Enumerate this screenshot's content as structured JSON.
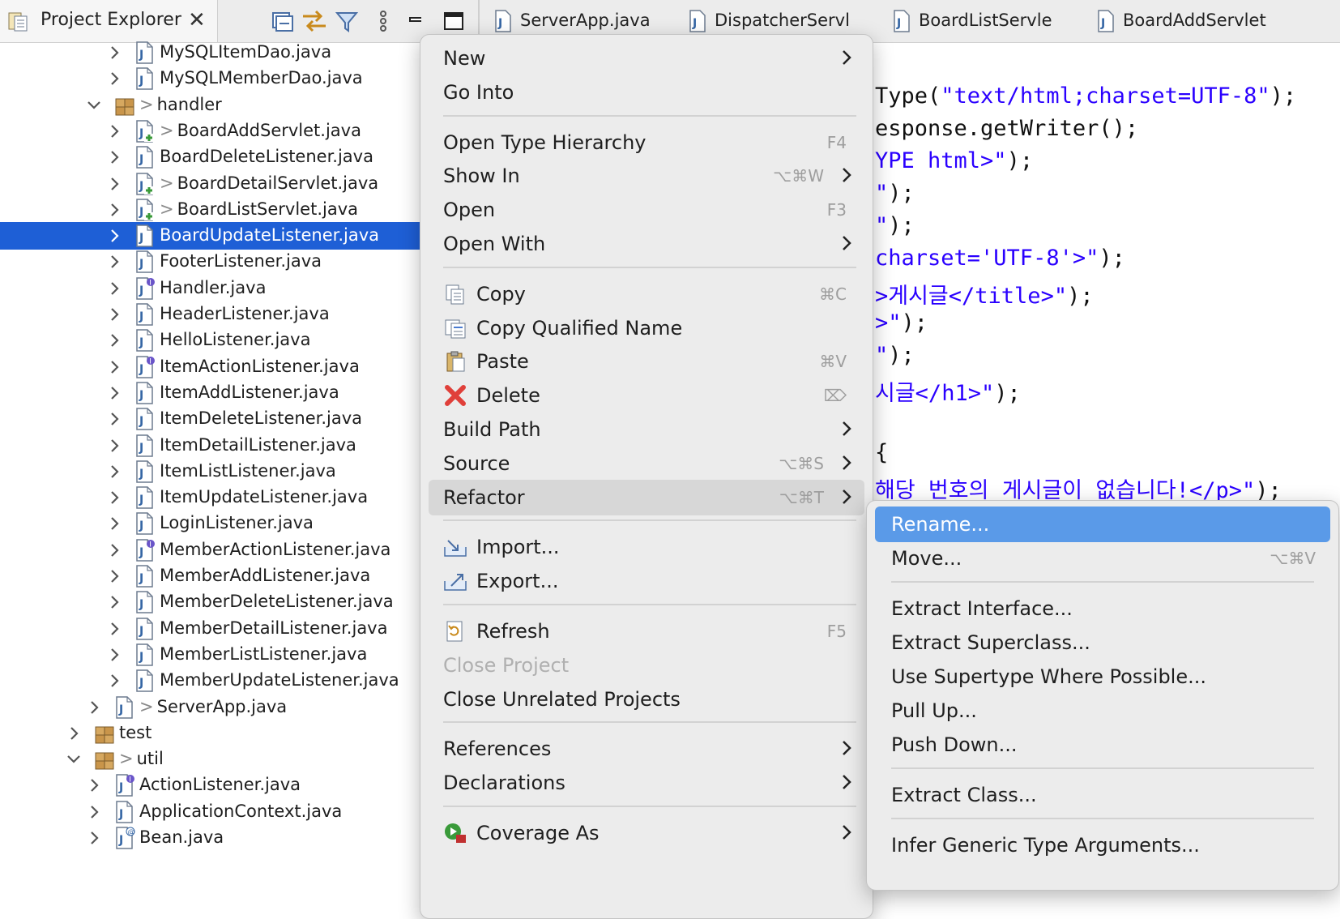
{
  "explorer": {
    "title": "Project Explorer",
    "close_glyph": "✕",
    "toolbar": [
      "collapse-all-icon",
      "link-with-editor-icon",
      "filter-icon",
      "view-menu-icon",
      "minimize-icon",
      "maximize-icon"
    ],
    "tree": [
      {
        "label": "MySQLItemDao.java",
        "icon": "java-file-icon",
        "prefix": ""
      },
      {
        "label": "MySQLMemberDao.java",
        "icon": "java-file-icon",
        "prefix": ""
      },
      {
        "label": "handler",
        "icon": "package-icon",
        "prefix": ">"
      },
      {
        "label": "BoardAddServlet.java",
        "icon": "java-file-added-icon",
        "prefix": ">"
      },
      {
        "label": "BoardDeleteListener.java",
        "icon": "java-file-icon",
        "prefix": ""
      },
      {
        "label": "BoardDetailServlet.java",
        "icon": "java-file-added-icon",
        "prefix": ">"
      },
      {
        "label": "BoardListServlet.java",
        "icon": "java-file-added-icon",
        "prefix": ">"
      },
      {
        "label": "BoardUpdateListener.java",
        "icon": "java-file-icon",
        "prefix": "",
        "selected": true
      },
      {
        "label": "FooterListener.java",
        "icon": "java-file-icon",
        "prefix": ""
      },
      {
        "label": "Handler.java",
        "icon": "java-interface-file-icon",
        "prefix": ""
      },
      {
        "label": "HeaderListener.java",
        "icon": "java-file-icon",
        "prefix": ""
      },
      {
        "label": "HelloListener.java",
        "icon": "java-file-icon",
        "prefix": ""
      },
      {
        "label": "ItemActionListener.java",
        "icon": "java-interface-file-icon",
        "prefix": ""
      },
      {
        "label": "ItemAddListener.java",
        "icon": "java-file-icon",
        "prefix": ""
      },
      {
        "label": "ItemDeleteListener.java",
        "icon": "java-file-icon",
        "prefix": ""
      },
      {
        "label": "ItemDetailListener.java",
        "icon": "java-file-icon",
        "prefix": ""
      },
      {
        "label": "ItemListListener.java",
        "icon": "java-file-icon",
        "prefix": ""
      },
      {
        "label": "ItemUpdateListener.java",
        "icon": "java-file-icon",
        "prefix": ""
      },
      {
        "label": "LoginListener.java",
        "icon": "java-file-icon",
        "prefix": ""
      },
      {
        "label": "MemberActionListener.java",
        "icon": "java-interface-file-icon",
        "prefix": ""
      },
      {
        "label": "MemberAddListener.java",
        "icon": "java-file-icon",
        "prefix": ""
      },
      {
        "label": "MemberDeleteListener.java",
        "icon": "java-file-icon",
        "prefix": ""
      },
      {
        "label": "MemberDetailListener.java",
        "icon": "java-file-icon",
        "prefix": ""
      },
      {
        "label": "MemberListListener.java",
        "icon": "java-file-icon",
        "prefix": ""
      },
      {
        "label": "MemberUpdateListener.java",
        "icon": "java-file-icon",
        "prefix": ""
      },
      {
        "label": "ServerApp.java",
        "icon": "java-file-icon",
        "prefix": ">"
      },
      {
        "label": "test",
        "icon": "package-icon",
        "prefix": ""
      },
      {
        "label": "util",
        "icon": "package-icon",
        "prefix": ">"
      },
      {
        "label": "ActionListener.java",
        "icon": "java-interface-file-icon",
        "prefix": ""
      },
      {
        "label": "ApplicationContext.java",
        "icon": "java-file-icon",
        "prefix": ""
      },
      {
        "label": "Bean.java",
        "icon": "java-annotation-file-icon",
        "prefix": ""
      }
    ]
  },
  "editor": {
    "tabs": [
      "ServerApp.java",
      "DispatcherServl",
      "BoardListServle",
      "BoardAddServlet"
    ],
    "code_lines": [
      {
        "parts": [
          {
            "t": "Type(",
            "c": "pl"
          },
          {
            "t": "\"text/html;charset=UTF-8\"",
            "c": "str"
          },
          {
            "t": ");",
            "c": "pl"
          }
        ]
      },
      {
        "parts": [
          {
            "t": "esponse.getWriter();",
            "c": "pl"
          }
        ]
      },
      {
        "parts": [
          {
            "t": "YPE html>\"",
            "c": "str"
          },
          {
            "t": ");",
            "c": "pl"
          }
        ]
      },
      {
        "parts": [
          {
            "t": "\"",
            "c": "str"
          },
          {
            "t": ");",
            "c": "pl"
          }
        ]
      },
      {
        "parts": [
          {
            "t": "\"",
            "c": "str"
          },
          {
            "t": ");",
            "c": "pl"
          }
        ]
      },
      {
        "parts": [
          {
            "t": "charset='UTF-8'>\"",
            "c": "str"
          },
          {
            "t": ");",
            "c": "pl"
          }
        ]
      },
      {
        "parts": [
          {
            "t": ">게시글</title>\"",
            "c": "str"
          },
          {
            "t": ");",
            "c": "pl"
          }
        ]
      },
      {
        "parts": [
          {
            "t": ">\"",
            "c": "str"
          },
          {
            "t": ");",
            "c": "pl"
          }
        ]
      },
      {
        "parts": [
          {
            "t": "\"",
            "c": "str"
          },
          {
            "t": ");",
            "c": "pl"
          }
        ]
      },
      {
        "parts": [
          {
            "t": "시글</h1>\"",
            "c": "str"
          },
          {
            "t": ");",
            "c": "pl"
          }
        ]
      },
      {
        "parts": []
      },
      {
        "parts": [
          {
            "t": "{",
            "c": "pl"
          }
        ]
      },
      {
        "parts": [
          {
            "t": "해당 번호의 게시글이 없습니다!</p>\"",
            "c": "str"
          },
          {
            "t": ");",
            "c": "pl"
          }
        ]
      }
    ]
  },
  "context_menu": {
    "items": [
      {
        "label": "New",
        "shortcut": "",
        "submenu": true
      },
      {
        "label": "Go Into",
        "shortcut": "",
        "submenu": false
      },
      {
        "sep": true
      },
      {
        "label": "Open Type Hierarchy",
        "shortcut": "F4",
        "submenu": false
      },
      {
        "label": "Show In",
        "shortcut": "⌥⌘W",
        "submenu": true
      },
      {
        "label": "Open",
        "shortcut": "F3",
        "submenu": false
      },
      {
        "label": "Open With",
        "shortcut": "",
        "submenu": true
      },
      {
        "sep": true
      },
      {
        "label": "Copy",
        "shortcut": "⌘C",
        "submenu": false,
        "icon": "copy-icon"
      },
      {
        "label": "Copy Qualified Name",
        "shortcut": "",
        "submenu": false,
        "icon": "copy-qualified-name-icon"
      },
      {
        "label": "Paste",
        "shortcut": "⌘V",
        "submenu": false,
        "icon": "paste-icon"
      },
      {
        "label": "Delete",
        "shortcut": "⌦",
        "submenu": false,
        "icon": "delete-icon"
      },
      {
        "label": "Build Path",
        "shortcut": "",
        "submenu": true
      },
      {
        "label": "Source",
        "shortcut": "⌥⌘S",
        "submenu": true
      },
      {
        "label": "Refactor",
        "shortcut": "⌥⌘T",
        "submenu": true,
        "highlighted": true
      },
      {
        "sep": true
      },
      {
        "label": "Import...",
        "shortcut": "",
        "submenu": false,
        "icon": "import-icon"
      },
      {
        "label": "Export...",
        "shortcut": "",
        "submenu": false,
        "icon": "export-icon"
      },
      {
        "sep": true
      },
      {
        "label": "Refresh",
        "shortcut": "F5",
        "submenu": false,
        "icon": "refresh-icon"
      },
      {
        "label": "Close Project",
        "shortcut": "",
        "submenu": false,
        "disabled": true
      },
      {
        "label": "Close Unrelated Projects",
        "shortcut": "",
        "submenu": false
      },
      {
        "sep": true
      },
      {
        "label": "References",
        "shortcut": "",
        "submenu": true
      },
      {
        "label": "Declarations",
        "shortcut": "",
        "submenu": true
      },
      {
        "sep": true
      },
      {
        "label": "Coverage As",
        "shortcut": "",
        "submenu": true,
        "icon": "coverage-icon"
      }
    ]
  },
  "refactor_submenu": {
    "items": [
      {
        "label": "Rename...",
        "shortcut": "",
        "active": true
      },
      {
        "label": "Move...",
        "shortcut": "⌥⌘V"
      },
      {
        "sep": true
      },
      {
        "label": "Extract Interface...",
        "shortcut": ""
      },
      {
        "label": "Extract Superclass...",
        "shortcut": ""
      },
      {
        "label": "Use Supertype Where Possible...",
        "shortcut": ""
      },
      {
        "label": "Pull Up...",
        "shortcut": ""
      },
      {
        "label": "Push Down...",
        "shortcut": ""
      },
      {
        "sep": true
      },
      {
        "label": "Extract Class...",
        "shortcut": ""
      },
      {
        "sep": true
      },
      {
        "label": "Infer Generic Type Arguments...",
        "shortcut": ""
      }
    ]
  },
  "colors": {
    "selection": "#1e5fd6",
    "menu_highlight": "#d7d7d7",
    "submenu_active": "#5a9ae8",
    "string_literal": "#2a00ff"
  }
}
